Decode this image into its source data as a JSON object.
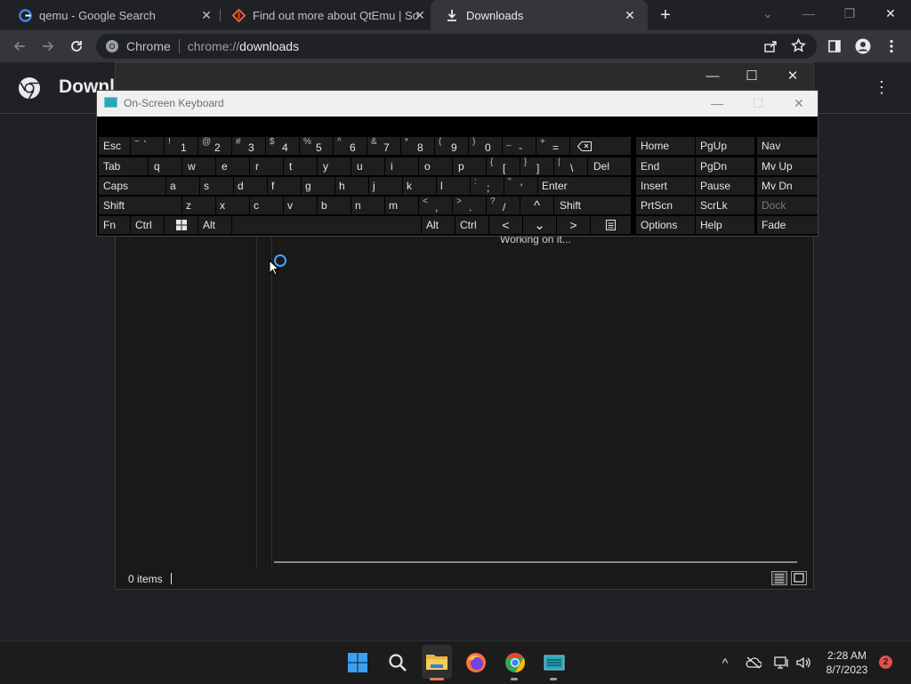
{
  "browser": {
    "tabs": [
      {
        "title": "qemu - Google Search",
        "icon": "google-icon",
        "active": false
      },
      {
        "title": "Find out more about QtEmu | So",
        "icon": "sourceforge-icon",
        "active": false
      },
      {
        "title": "Downloads",
        "icon": "download-icon",
        "active": true
      }
    ],
    "tab_close": "✕",
    "new_tab": "+",
    "window_controls": {
      "menu": "⌄",
      "minimize": "—",
      "restore": "❐",
      "close": "✕"
    },
    "omnibox": {
      "site_chip": "Chrome",
      "scheme": "chrome://",
      "host": "downloads"
    }
  },
  "downloads_page": {
    "title": "Downloads",
    "menu": "⋮"
  },
  "dialog": {
    "controls": {
      "minimize": "—",
      "maximize": "☐",
      "close": "✕"
    },
    "status": "Working on it...",
    "items_count": "0 items"
  },
  "osk": {
    "title": "On-Screen Keyboard",
    "controls": {
      "minimize": "—",
      "maximize": "☐",
      "close": "✕"
    },
    "keys": {
      "esc": "Esc",
      "tilde_sup": "~",
      "tilde": "`",
      "n1s": "!",
      "n1": "1",
      "n2s": "@",
      "n2": "2",
      "n3s": "#",
      "n3": "3",
      "n4s": "$",
      "n4": "4",
      "n5s": "%",
      "n5": "5",
      "n6s": "^",
      "n6": "6",
      "n7s": "&",
      "n7": "7",
      "n8s": "*",
      "n8": "8",
      "n9s": "(",
      "n9": "9",
      "n0s": ")",
      "n0": "0",
      "minus_s": "_",
      "minus": "-",
      "eq_s": "+",
      "eq": "=",
      "tab": "Tab",
      "q": "q",
      "w": "w",
      "e": "e",
      "r": "r",
      "t": "t",
      "y": "y",
      "u": "u",
      "i": "i",
      "o": "o",
      "p": "p",
      "lb_s": "{",
      "lb": "[",
      "rb_s": "}",
      "rb": "]",
      "bs_s": "|",
      "bs": "\\",
      "del": "Del",
      "caps": "Caps",
      "a": "a",
      "s": "s",
      "d": "d",
      "f": "f",
      "g": "g",
      "h": "h",
      "j": "j",
      "k": "k",
      "l": "l",
      "semi_s": ":",
      "semi": ";",
      "quote_s": "\"",
      "quote": "'",
      "enter": "Enter",
      "shift": "Shift",
      "z": "z",
      "x": "x",
      "c": "c",
      "v": "v",
      "b": "b",
      "n": "n",
      "m": "m",
      "comma_s": "<",
      "comma": ",",
      "dot_s": ">",
      "dot": ".",
      "slash_s": "?",
      "slash": "/",
      "up": "^",
      "shift_r": "Shift",
      "fn": "Fn",
      "ctrl": "Ctrl",
      "alt": "Alt",
      "alt_r": "Alt",
      "ctrl_r": "Ctrl",
      "left": "<",
      "down": "⌄",
      "right": ">",
      "home": "Home",
      "pgup": "PgUp",
      "nav": "Nav",
      "end": "End",
      "pgdn": "PgDn",
      "mvup": "Mv Up",
      "insert": "Insert",
      "pause": "Pause",
      "mvdn": "Mv Dn",
      "prtscn": "PrtScn",
      "scrlk": "ScrLk",
      "dock": "Dock",
      "options": "Options",
      "help": "Help",
      "fade": "Fade"
    }
  },
  "taskbar": {
    "apps": [
      "windows-start-icon",
      "search-icon",
      "file-explorer-icon",
      "firefox-icon",
      "chrome-icon",
      "osk-app-icon"
    ],
    "tray": {
      "chevron": "^"
    },
    "time": "2:28 AM",
    "date": "8/7/2023",
    "notifications": "2"
  }
}
